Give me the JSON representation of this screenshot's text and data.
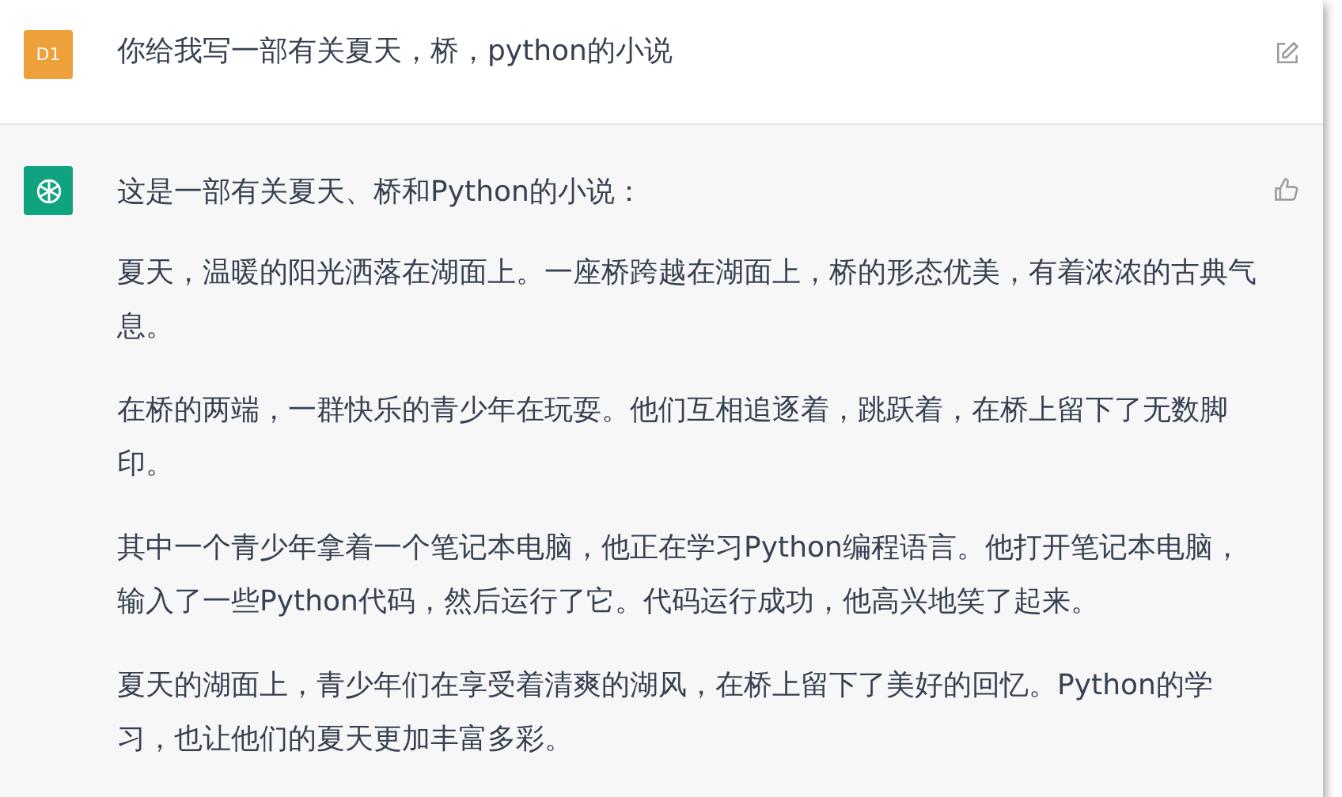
{
  "user_message": {
    "avatar": "D1",
    "text": "你给我写一部有关夏天，桥，python的小说"
  },
  "assistant_message": {
    "paragraphs": [
      "这是一部有关夏天、桥和Python的小说：",
      "夏天，温暖的阳光洒落在湖面上。一座桥跨越在湖面上，桥的形态优美，有着浓浓的古典气息。",
      "在桥的两端，一群快乐的青少年在玩耍。他们互相追逐着，跳跃着，在桥上留下了无数脚印。",
      "其中一个青少年拿着一个笔记本电脑，他正在学习Python编程语言。他打开笔记本电脑，输入了一些Python代码，然后运行了它。代码运行成功，他高兴地笑了起来。",
      "夏天的湖面上，青少年们在享受着清爽的湖风，在桥上留下了美好的回忆。Python的学习，也让他们的夏天更加丰富多彩。"
    ]
  }
}
